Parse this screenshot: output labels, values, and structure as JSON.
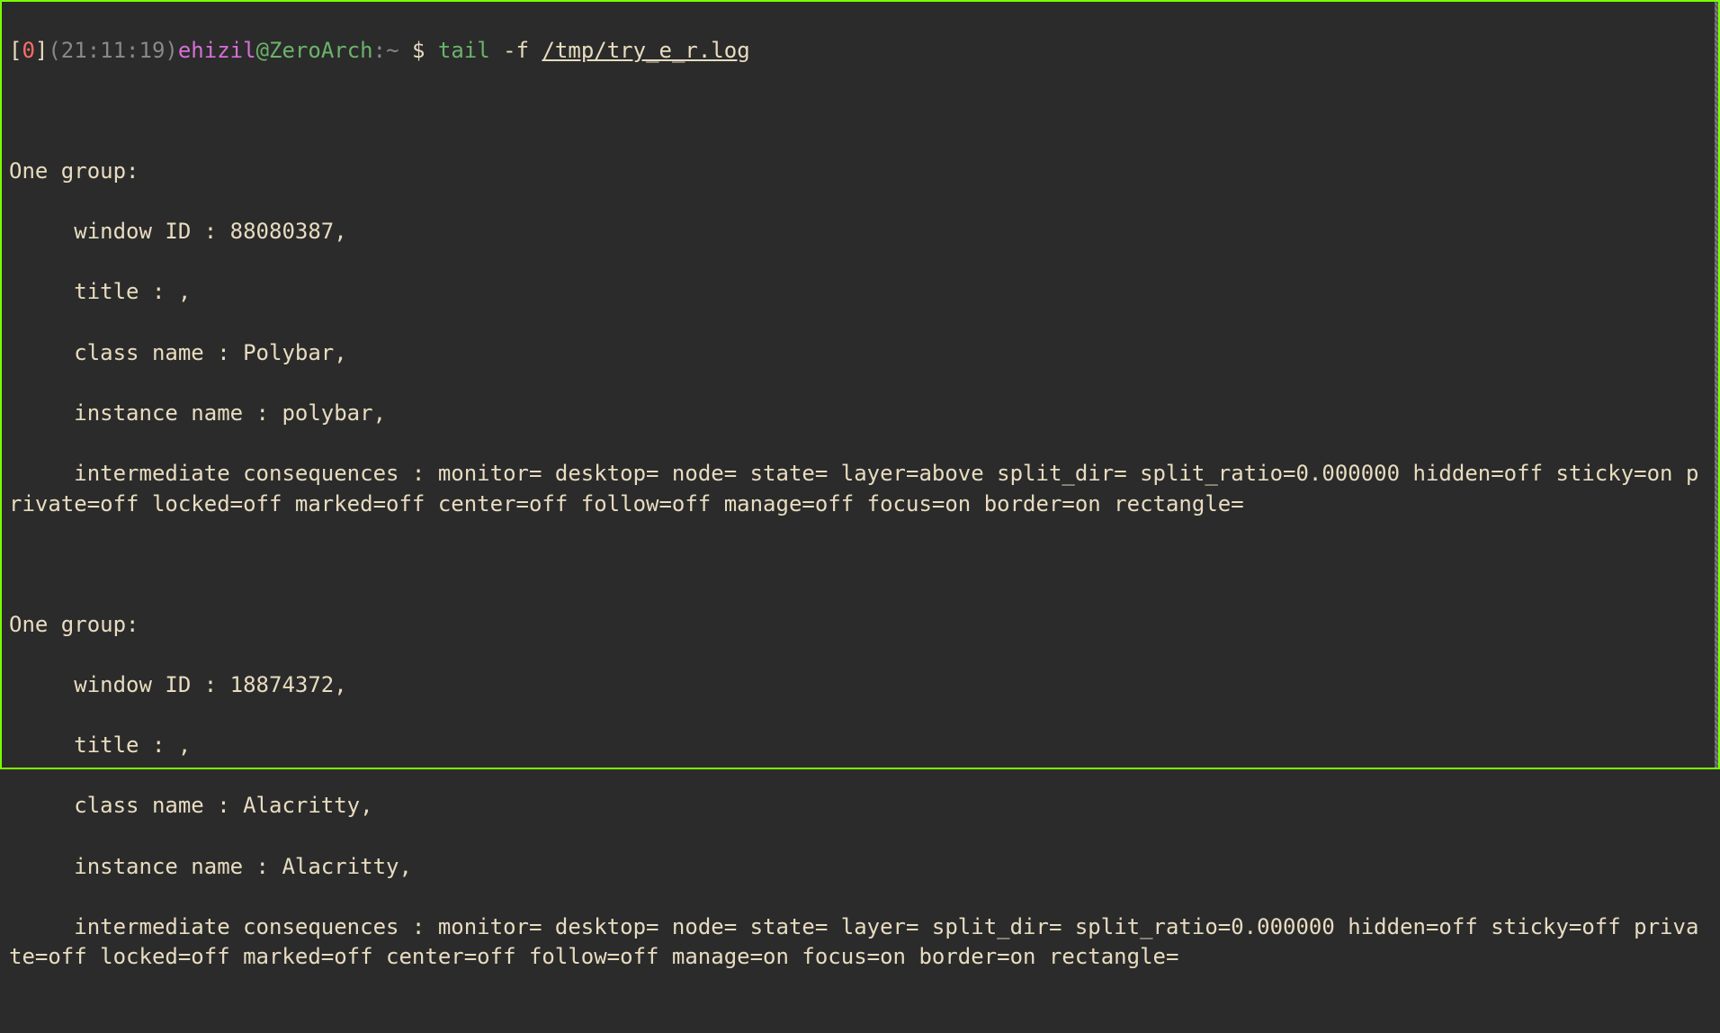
{
  "prompt": {
    "bracket_open": "[",
    "exit_code": "0",
    "bracket_close": "]",
    "time": "(21:11:19)",
    "user": "ehizil",
    "at": "@",
    "host": "ZeroArch",
    "colon": ":",
    "cwd": "~",
    "dollar": " $ ",
    "cmd": "tail",
    "flag": " -f ",
    "path": "/tmp/try_e_r.log"
  },
  "output": {
    "blank1": "",
    "blank2": "",
    "g1_header": "One group:",
    "g1_winid": "     window ID : 88080387,",
    "g1_title": "     title : ,",
    "g1_class": "     class name : Polybar,",
    "g1_instance": "     instance name : polybar,",
    "g1_consq": "     intermediate consequences : monitor= desktop= node= state= layer=above split_dir= split_ratio=0.000000 hidden=off sticky=on private=off locked=off marked=off center=off follow=off manage=off focus=on border=on rectangle=",
    "blank3": "",
    "blank4": "",
    "g2_header": "One group:",
    "g2_winid": "     window ID : 18874372,",
    "g2_title": "     title : ,",
    "g2_class": "     class name : Alacritty,",
    "g2_instance": "     instance name : Alacritty,",
    "g2_consq": "     intermediate consequences : monitor= desktop= node= state= layer= split_dir= split_ratio=0.000000 hidden=off sticky=off private=off locked=off marked=off center=off follow=off manage=on focus=on border=on rectangle="
  }
}
